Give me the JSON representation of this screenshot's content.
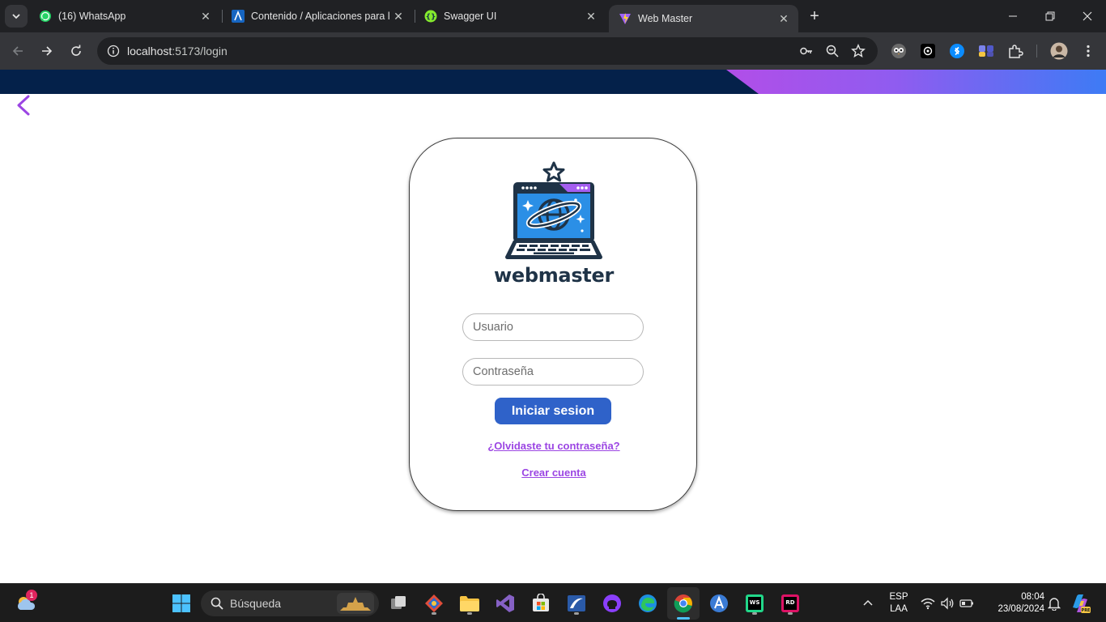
{
  "browser": {
    "tabs": [
      {
        "title": "(16) WhatsApp",
        "favicon": "whatsapp-icon",
        "active": false
      },
      {
        "title": "Contenido / Aplicaciones para l",
        "favicon": "azure-icon",
        "active": false
      },
      {
        "title": "Swagger UI",
        "favicon": "swagger-icon",
        "active": false
      },
      {
        "title": "Web Master",
        "favicon": "vite-icon",
        "active": true
      }
    ],
    "url_host": "localhost",
    "url_path": ":5173/login"
  },
  "page": {
    "logo_text": "webmaster",
    "username_placeholder": "Usuario",
    "password_placeholder": "Contraseña",
    "login_button": "Iniciar sesion",
    "forgot_link": "¿Olvidaste tu contraseña?",
    "create_account_link": "Crear cuenta",
    "colors": {
      "banner": "#04214a",
      "button": "#2f62c9",
      "link": "#9b45e3",
      "logo_text": "#1f3347"
    }
  },
  "taskbar": {
    "search_label": "Búsqueda",
    "weather_badge": "1",
    "language": "ESP",
    "keyboard": "LAA",
    "time": "08:04",
    "date": "23/08/2024"
  }
}
